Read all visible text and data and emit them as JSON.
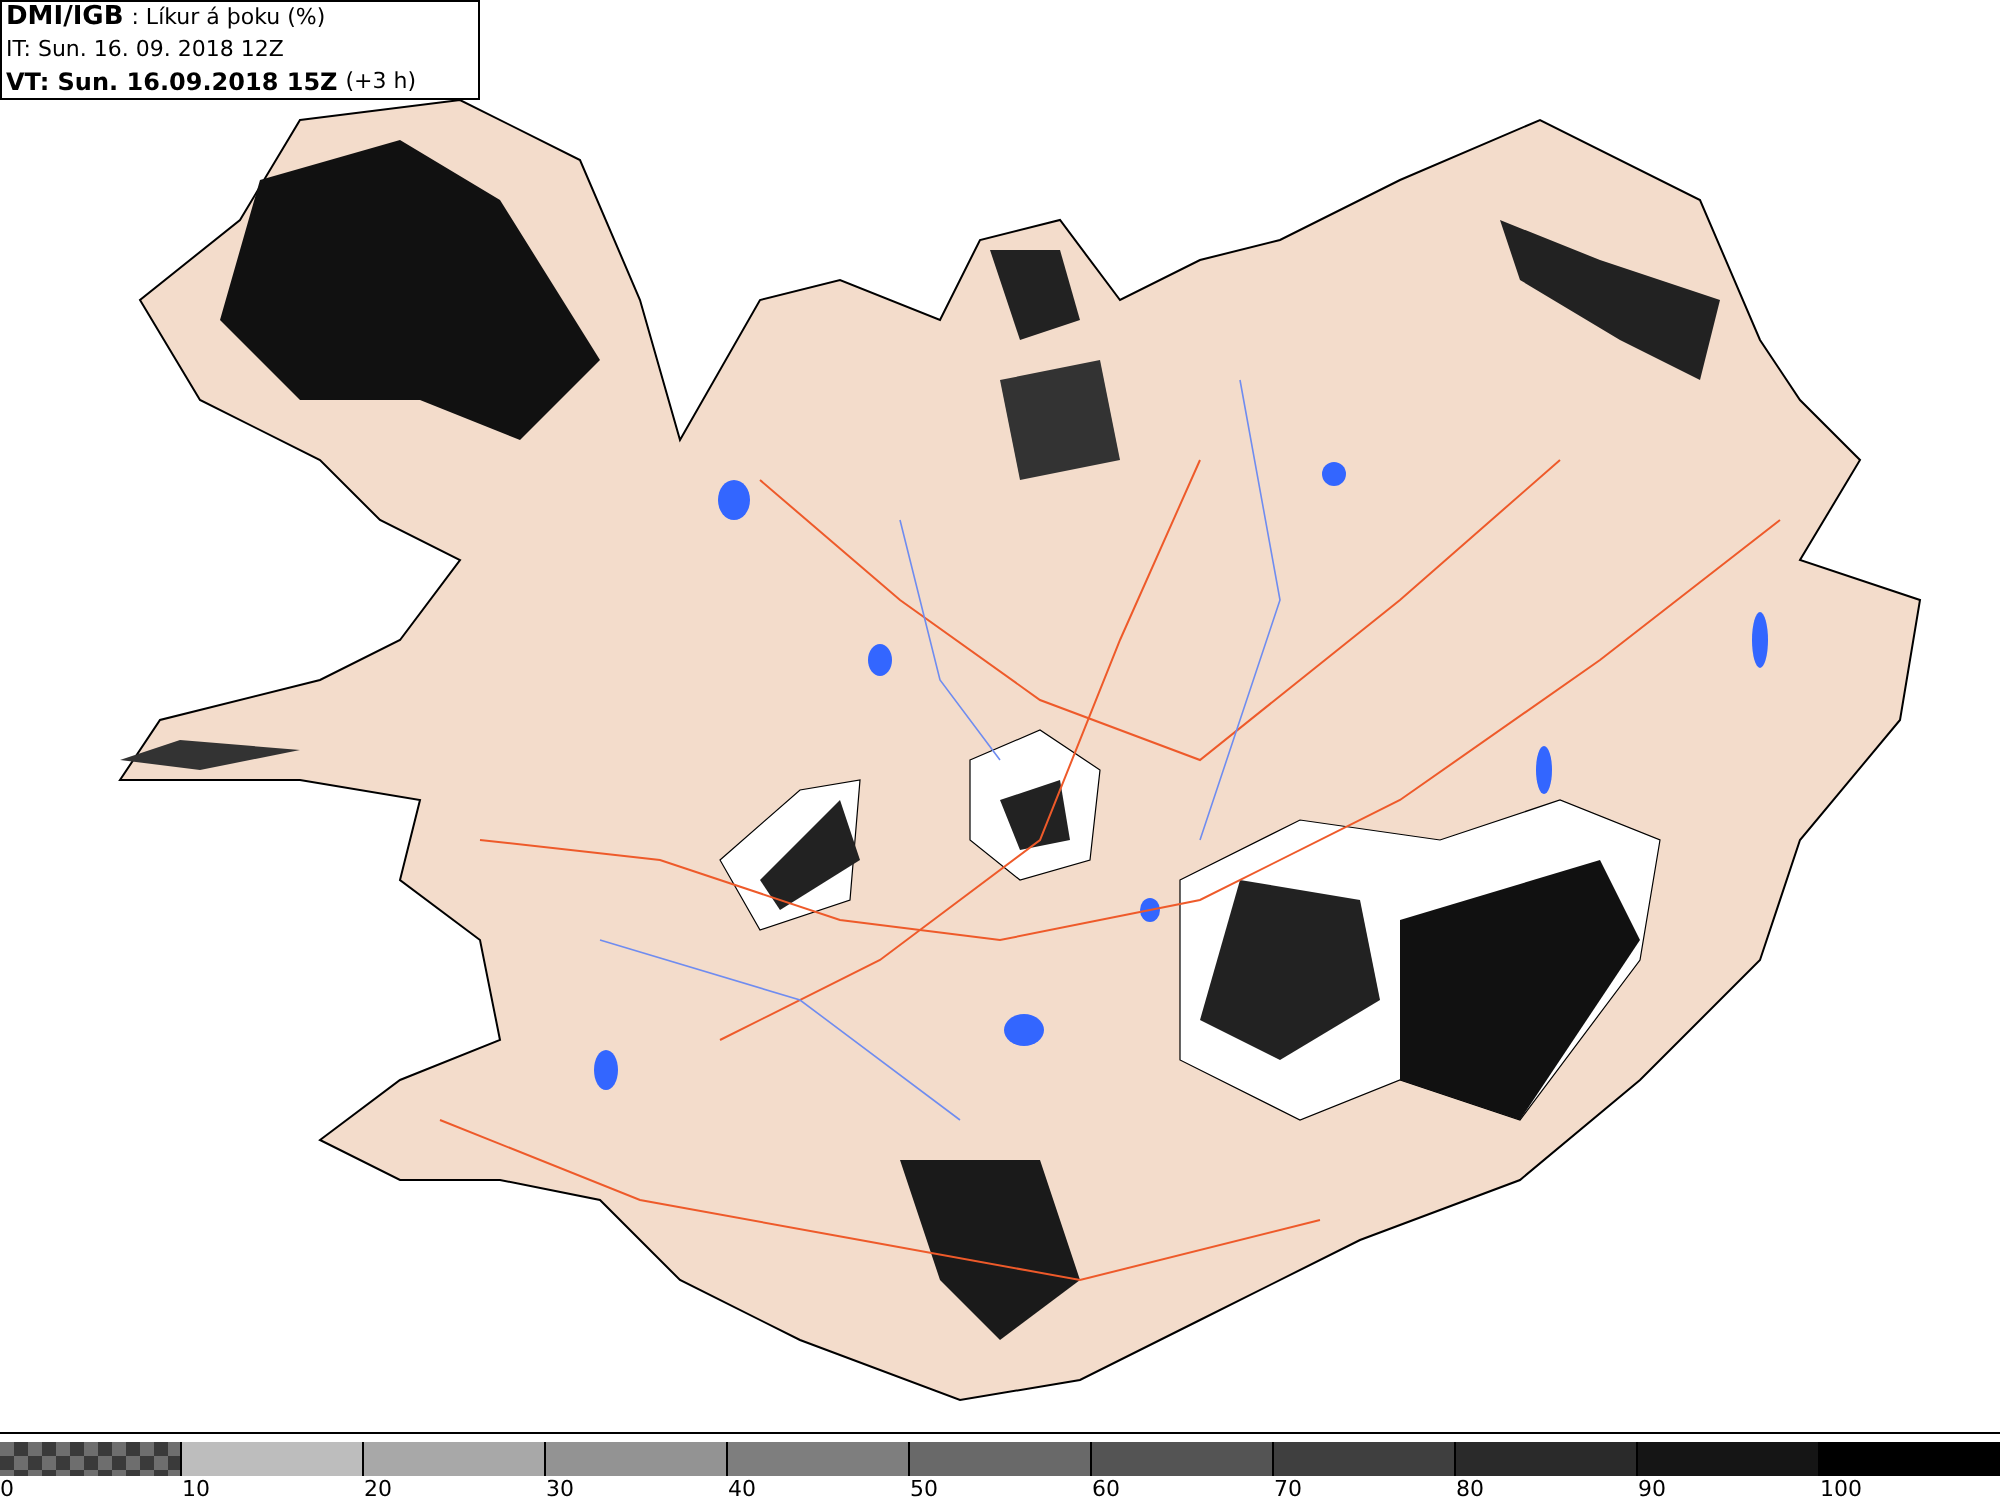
{
  "header": {
    "source": "DMI/IGB",
    "parameter": ": Líkur á þoku (%)",
    "initial_time": "IT: Sun. 16. 09. 2018 12Z",
    "valid_time": "VT: Sun. 16.09.2018 15Z",
    "offset": "(+3 h)"
  },
  "legend": [
    {
      "kind": "checker",
      "label": "0",
      "color": "#6e6e6e"
    },
    {
      "kind": "solid",
      "label": "10",
      "color": "#bdbdbd"
    },
    {
      "kind": "solid",
      "label": "20",
      "color": "#a8a8a8"
    },
    {
      "kind": "solid",
      "label": "30",
      "color": "#939393"
    },
    {
      "kind": "solid",
      "label": "40",
      "color": "#7e7e7e"
    },
    {
      "kind": "solid",
      "label": "50",
      "color": "#696969"
    },
    {
      "kind": "solid",
      "label": "60",
      "color": "#545454"
    },
    {
      "kind": "solid",
      "label": "70",
      "color": "#3f3f3f"
    },
    {
      "kind": "solid",
      "label": "80",
      "color": "#2a2a2a"
    },
    {
      "kind": "solid",
      "label": "90",
      "color": "#151515"
    },
    {
      "kind": "solid",
      "label": "100",
      "color": "#000000"
    }
  ]
}
